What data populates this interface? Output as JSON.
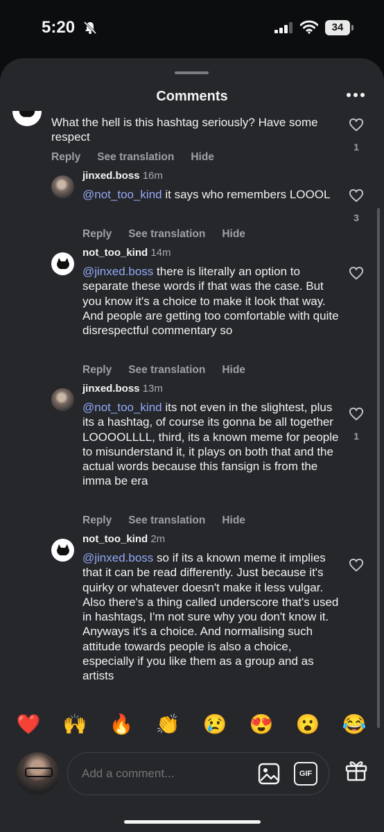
{
  "status_bar": {
    "time": "5:20",
    "battery": "34"
  },
  "sheet": {
    "title": "Comments"
  },
  "comments": [
    {
      "username": "",
      "time": "",
      "text_parts": [
        "What the hell is this hashtag seriously? Have some respect"
      ],
      "mention": "",
      "actions": [
        "Reply",
        "See translation",
        "Hide"
      ],
      "likes": "1"
    },
    {
      "username": "jinxed.boss",
      "time": "16m",
      "mention": "@not_too_kind",
      "text": " it says who remembers LOOOL",
      "actions": [
        "Reply",
        "See translation",
        "Hide"
      ],
      "likes": "3"
    },
    {
      "username": "not_too_kind",
      "time": "14m",
      "mention": "@jinxed.boss",
      "text": " there is literally an option to separate these words if that was the case. But you know it's a choice to make it look that way. And people are getting too comfortable with quite disrespectful commentary so",
      "actions": [
        "Reply",
        "See translation",
        "Hide"
      ],
      "likes": ""
    },
    {
      "username": "jinxed.boss",
      "time": "13m",
      "mention": "@not_too_kind",
      "text": " its not even in the slightest, plus its a hashtag, of course its gonna be all together LOOOOLLLL, third, its a known meme for people to misunderstand it, it plays on both that and the actual words because this fansign is from the imma be era",
      "actions": [
        "Reply",
        "See translation",
        "Hide"
      ],
      "likes": "1"
    },
    {
      "username": "not_too_kind",
      "time": "2m",
      "mention": "@jinxed.boss",
      "text": " so if its a known meme it implies that it can be read differently. Just because it's quirky or whatever doesn't make it less vulgar. Also there's a thing called underscore that's used in hashtags, I'm not sure why you don't know it. Anyways it's a choice. And normalising such attitude towards people is also a choice, especially if you like them as a group and as artists",
      "actions": [],
      "likes": ""
    }
  ],
  "emoji_row": [
    "❤️",
    "🙌",
    "🔥",
    "👏",
    "😢",
    "😍",
    "😮",
    "😂"
  ],
  "input": {
    "placeholder": "Add a comment...",
    "gif_label": "GIF"
  },
  "icons": {
    "bell": "bell-slash-icon",
    "signal": "signal-icon",
    "wifi": "wifi-icon",
    "heart": "heart-outline-icon",
    "gift": "gift-icon",
    "image": "image-icon"
  }
}
